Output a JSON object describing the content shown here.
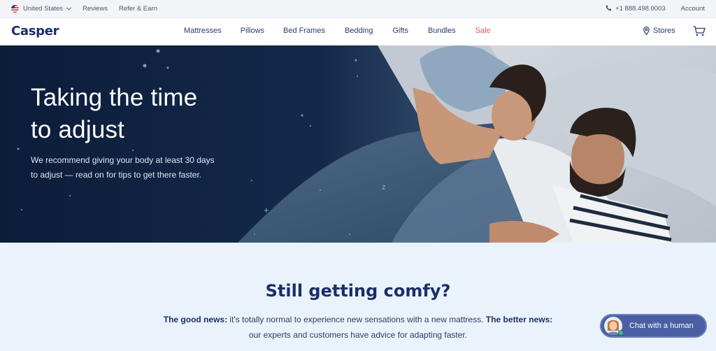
{
  "utility_bar": {
    "country": "United States",
    "reviews": "Reviews",
    "refer": "Refer & Earn",
    "phone": "+1 888.498.0003",
    "account": "Account"
  },
  "nav": {
    "logo": "Casper",
    "items": [
      "Mattresses",
      "Pillows",
      "Bed Frames",
      "Bedding",
      "Gifts",
      "Bundles",
      "Sale"
    ],
    "stores": "Stores"
  },
  "hero": {
    "title_line1": "Taking the time",
    "title_line2": "to adjust",
    "subtitle_line1": "We recommend giving your body at least 30 days",
    "subtitle_line2": "to adjust — read on for tips to get there faster."
  },
  "section": {
    "heading": "Still getting comfy?",
    "good_news_label": "The good news:",
    "good_news_text": " it's totally normal to experience new sensations with a new mattress. ",
    "better_news_label": "The better news:",
    "better_news_text": "our experts and customers have advice for adapting faster."
  },
  "chat": {
    "label": "Chat with a human"
  },
  "colors": {
    "brand_navy": "#1c2d6b",
    "sale_red": "#e4564b",
    "hero_bg": "#0f2140",
    "section_bg": "#eaf3fb",
    "chat_bg": "#4a5fa3",
    "status_green": "#39c46f"
  }
}
